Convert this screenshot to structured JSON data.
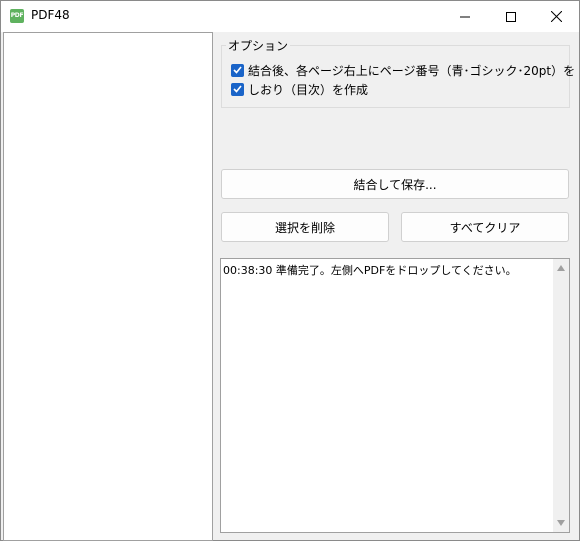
{
  "window": {
    "title": "PDF48",
    "icon_label": "PDF",
    "accent_color": "#1a64c8"
  },
  "titlebar_controls": {
    "minimize_icon": "minimize-icon",
    "maximize_icon": "maximize-icon",
    "close_icon": "close-icon"
  },
  "options": {
    "group_title": "オプション",
    "page_number_label": "結合後、各ページ右上にページ番号（青･ゴシック･20pt）を",
    "page_number_checked": true,
    "bookmark_label": "しおり（目次）を作成",
    "bookmark_checked": true
  },
  "buttons": {
    "save_label": "結合して保存...",
    "delete_label": "選択を削除",
    "clear_label": "すべてクリア"
  },
  "log": {
    "lines": [
      "00:38:30 準備完了。左側へPDFをドロップしてください。"
    ]
  }
}
